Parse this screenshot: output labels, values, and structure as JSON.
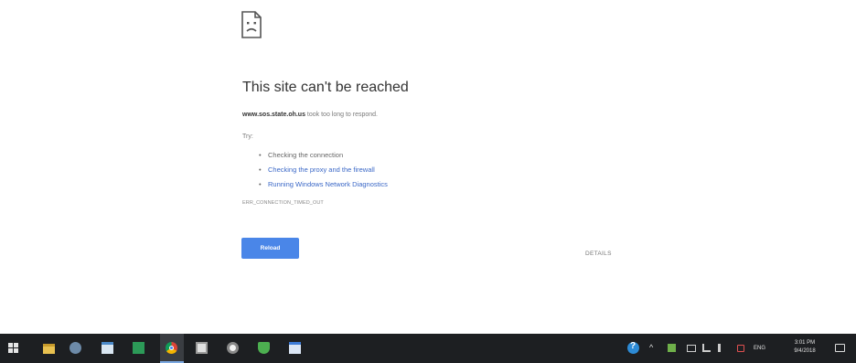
{
  "error_page": {
    "title": "This site can't be reached",
    "domain": "www.sos.state.oh.us",
    "description_suffix": " took too long to respond.",
    "try_label": "Try:",
    "suggestions": [
      {
        "label": "Checking the connection",
        "is_link": false
      },
      {
        "label": "Checking the proxy and the firewall",
        "is_link": true
      },
      {
        "label": "Running Windows Network Diagnostics",
        "is_link": true
      }
    ],
    "error_code": "ERR_CONNECTION_TIMED_OUT",
    "reload_label": "Reload",
    "details_label": "DETAILS",
    "icon": "sad-page-icon"
  },
  "taskbar": {
    "pinned_icons": [
      "windows-start-icon",
      "file-explorer-icon",
      "photos-icon",
      "notepad-icon",
      "spreadsheet-icon",
      "chrome-icon",
      "calculator-icon",
      "settings-icon",
      "windows-defender-icon",
      "document-icon"
    ],
    "active_app": "chrome-icon",
    "tray": {
      "up_arrow": "^",
      "language": "ENG",
      "time": "3:01 PM",
      "date": "9/4/2018"
    }
  },
  "colors": {
    "accent": "#4a86e8",
    "link": "#3b68c7",
    "taskbar": "#1d1f22"
  }
}
